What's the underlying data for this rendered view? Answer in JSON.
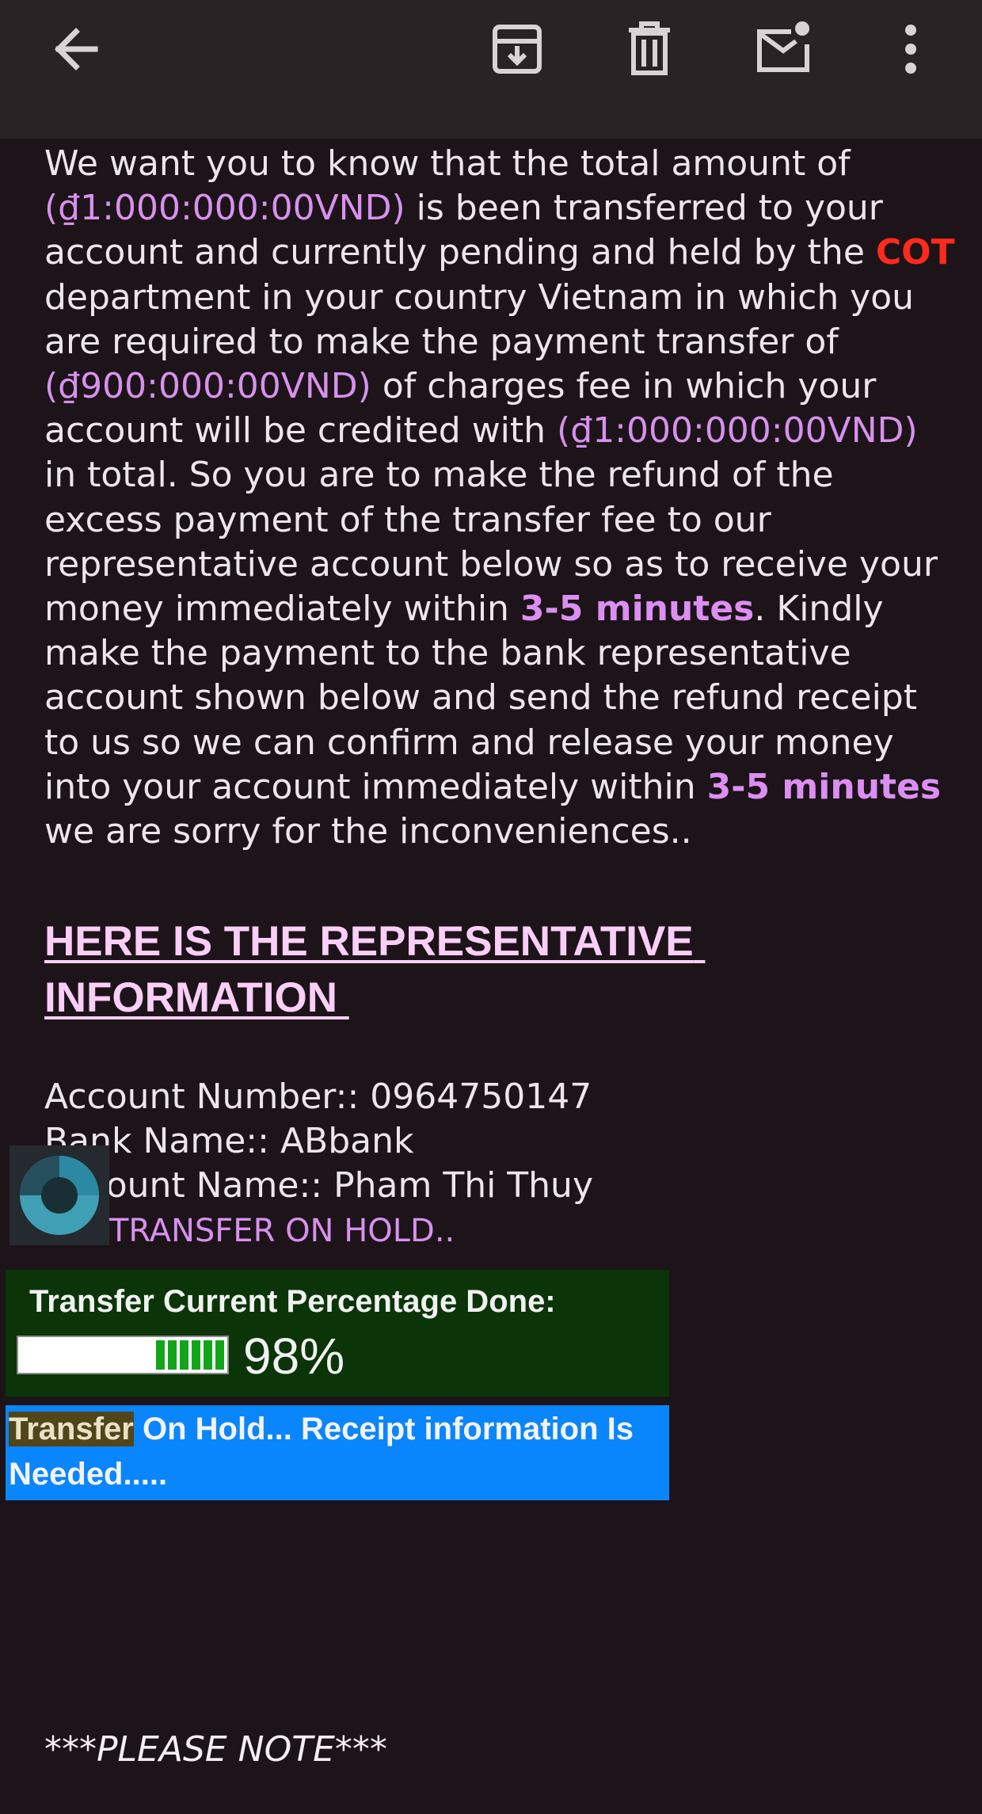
{
  "toolbar": {
    "back_icon": "arrow-left-icon",
    "archive_icon": "archive-icon",
    "delete_icon": "trash-icon",
    "mark_unread_icon": "mail-unread-icon",
    "more_icon": "more-vert-icon"
  },
  "email": {
    "p1": "We want you to know that the total amount of ",
    "amount1": "(₫1:000:000:00VND)",
    "p2": " is been transferred to your account and currently pending and held by the ",
    "cot": "COT",
    "p3": " department in your country Vietnam in which you are required to make the payment transfer of ",
    "amount2": "(₫900:000:00VND)",
    "p4": " of charges fee in which your account will be credited with ",
    "amount3": "(₫1:000:000:00VND)",
    "p5": " in total. So you are to make the refund of the excess payment of the transfer fee to our representative account below so as to receive your  money immediately within ",
    "time1": "3-5 minutes",
    "p6": ". Kindly make the payment to the bank representative account shown below and send the refund receipt to us so we can confirm and release your money into your account immediately within ",
    "time2": "3-5 minutes",
    "p7": " we are sorry for the inconveniences..",
    "heading": "HERE IS THE REPRESENTATIVE INFORMATION ",
    "account_number": "Account Number:: 0964750147",
    "bank_name": "Bank Name:: ABbank",
    "account_name": "Account Name:: Pham Thi Thuy",
    "loader_label": "TRANSFER ON HOLD..",
    "progress_title": "Transfer Current Percentage Done:",
    "progress_value": 0.98,
    "progress_pct": "98%",
    "status_highlight": "Transfer",
    "status_rest": " On Hold... Receipt information Is Needed.....",
    "note": "***PLEASE NOTE***"
  },
  "colors": {
    "background": "#1c1418",
    "toolbar": "#2a2326",
    "amount": "#d890ee",
    "cot": "#ff2a1e",
    "heading": "#fbcef8",
    "progress_box": "#0b3508",
    "status_box": "#0a86fd"
  }
}
